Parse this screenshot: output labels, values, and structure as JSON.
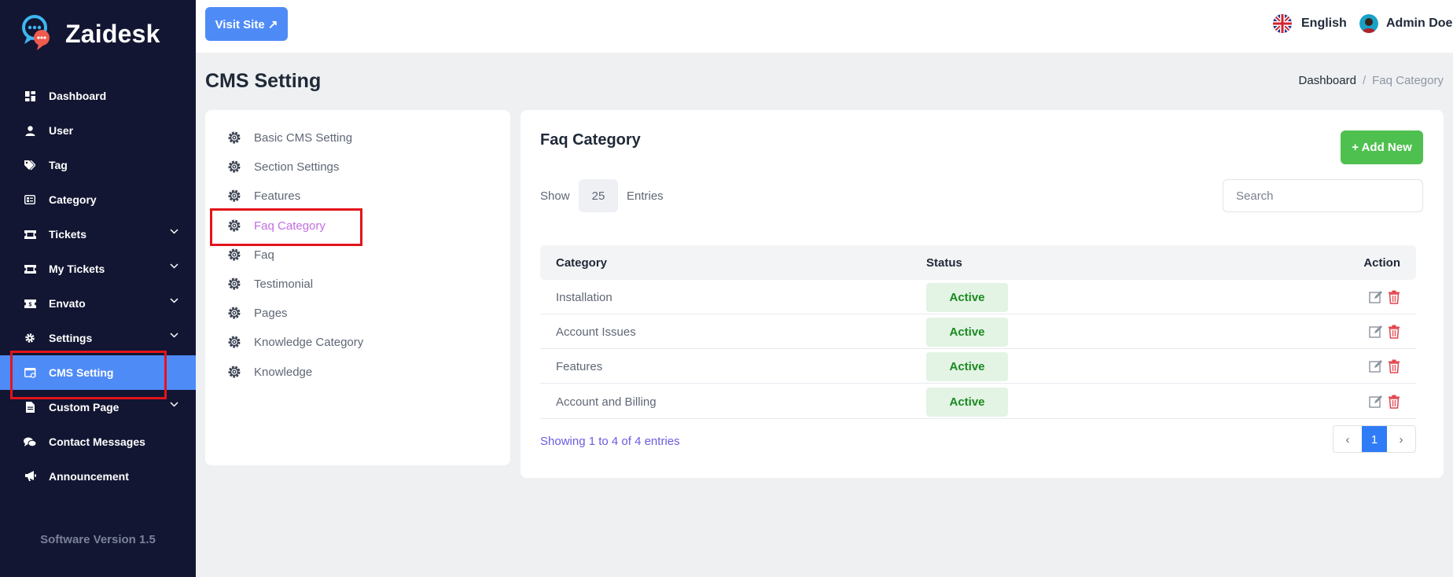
{
  "brand": {
    "name": "Zaidesk"
  },
  "sidebar": {
    "items": [
      {
        "label": "Dashboard",
        "icon": "grid-icon"
      },
      {
        "label": "User",
        "icon": "user-icon"
      },
      {
        "label": "Tag",
        "icon": "tags-icon"
      },
      {
        "label": "Category",
        "icon": "category-icon"
      },
      {
        "label": "Tickets",
        "icon": "ticket-icon",
        "has_submenu": true
      },
      {
        "label": "My Tickets",
        "icon": "ticket-icon",
        "has_submenu": true
      },
      {
        "label": "Envato",
        "icon": "envato-icon",
        "has_submenu": true
      },
      {
        "label": "Settings",
        "icon": "gear-icon",
        "has_submenu": true
      },
      {
        "label": "CMS Setting",
        "icon": "cms-icon",
        "active": true
      },
      {
        "label": "Custom Page",
        "icon": "file-icon",
        "has_submenu": true
      },
      {
        "label": "Contact Messages",
        "icon": "chat-icon"
      },
      {
        "label": "Announcement",
        "icon": "megaphone-icon"
      }
    ],
    "version": "Software Version 1.5"
  },
  "topbar": {
    "visit_site": "Visit Site ↗",
    "language": "English",
    "user_name": "Admin Doe"
  },
  "page": {
    "title": "CMS Setting",
    "breadcrumb": {
      "home": "Dashboard",
      "separator": "/",
      "current": "Faq Category"
    }
  },
  "cms_menu": {
    "items": [
      {
        "label": "Basic CMS Setting"
      },
      {
        "label": "Section Settings"
      },
      {
        "label": "Features"
      },
      {
        "label": "Faq Category",
        "active": true
      },
      {
        "label": "Faq"
      },
      {
        "label": "Testimonial"
      },
      {
        "label": "Pages"
      },
      {
        "label": "Knowledge Category"
      },
      {
        "label": "Knowledge"
      }
    ]
  },
  "main": {
    "title": "Faq Category",
    "add_button": "+ Add New",
    "show_label": "Show",
    "entries_value": "25",
    "entries_label": "Entries",
    "search_placeholder": "Search",
    "table": {
      "headers": {
        "category": "Category",
        "status": "Status",
        "action": "Action"
      },
      "rows": [
        {
          "category": "Installation",
          "status": "Active"
        },
        {
          "category": "Account Issues",
          "status": "Active"
        },
        {
          "category": "Features",
          "status": "Active"
        },
        {
          "category": "Account and Billing",
          "status": "Active"
        }
      ]
    },
    "showing": "Showing 1 to 4 of 4 entries",
    "pagination": {
      "prev": "‹",
      "page": "1",
      "next": "›"
    }
  },
  "colors": {
    "sidebar_bg": "#121632",
    "accent": "#4f8bf7",
    "add_green": "#4ec04f",
    "active_badge_bg": "#e3f3e4",
    "active_badge_text": "#1a8a1f",
    "cms_active_text": "#c26ee0",
    "highlight_red": "#e3141b"
  }
}
